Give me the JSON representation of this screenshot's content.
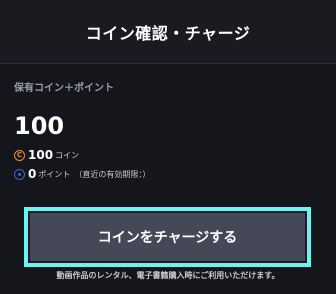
{
  "header": {
    "title": "コイン確認・チャージ"
  },
  "balance": {
    "label": "保有コイン＋ポイント",
    "total": "100",
    "coin": {
      "icon": "coin-icon",
      "badge": "C",
      "value": "100",
      "unit": "コイン",
      "color": "#e0922a"
    },
    "point": {
      "icon": "point-icon",
      "value": "0",
      "unit": "ポイント",
      "note": "（直近の有効期限：）",
      "color": "#3a67c8"
    }
  },
  "charge_button": {
    "label": "コインをチャージする"
  },
  "footnote": "動画作品のレンタル、電子書籍購入時にご利用いただけます。",
  "colors": {
    "accent_outline": "#6ef3ee",
    "button_bg": "#454856",
    "page_bg": "#14161c"
  }
}
